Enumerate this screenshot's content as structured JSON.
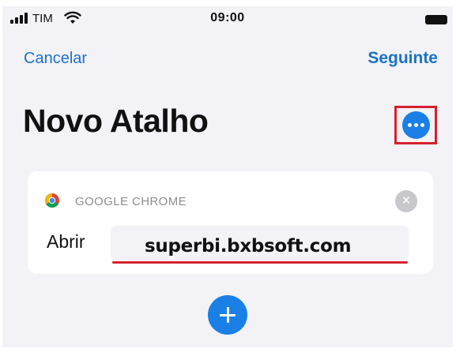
{
  "status_bar": {
    "carrier": "TIM",
    "time": "09:00",
    "icons": [
      "signal-icon",
      "wifi-icon",
      "battery-icon"
    ]
  },
  "nav": {
    "cancel_label": "Cancelar",
    "next_label": "Seguinte"
  },
  "page": {
    "title": "Novo Atalho",
    "more_icon": "ellipsis-icon"
  },
  "action_card": {
    "app_icon": "google-chrome-icon",
    "app_name": "GOOGLE CHROME",
    "action_label": "Abrir",
    "url_value": "superbi.bxbsoft.com",
    "clear_icon": "close-circle-icon"
  },
  "add_action_icon": "plus-icon",
  "colors": {
    "accent": "#1a80e5",
    "link": "#1a73c8",
    "highlight": "#d6202e",
    "background": "#f2f2f7"
  }
}
